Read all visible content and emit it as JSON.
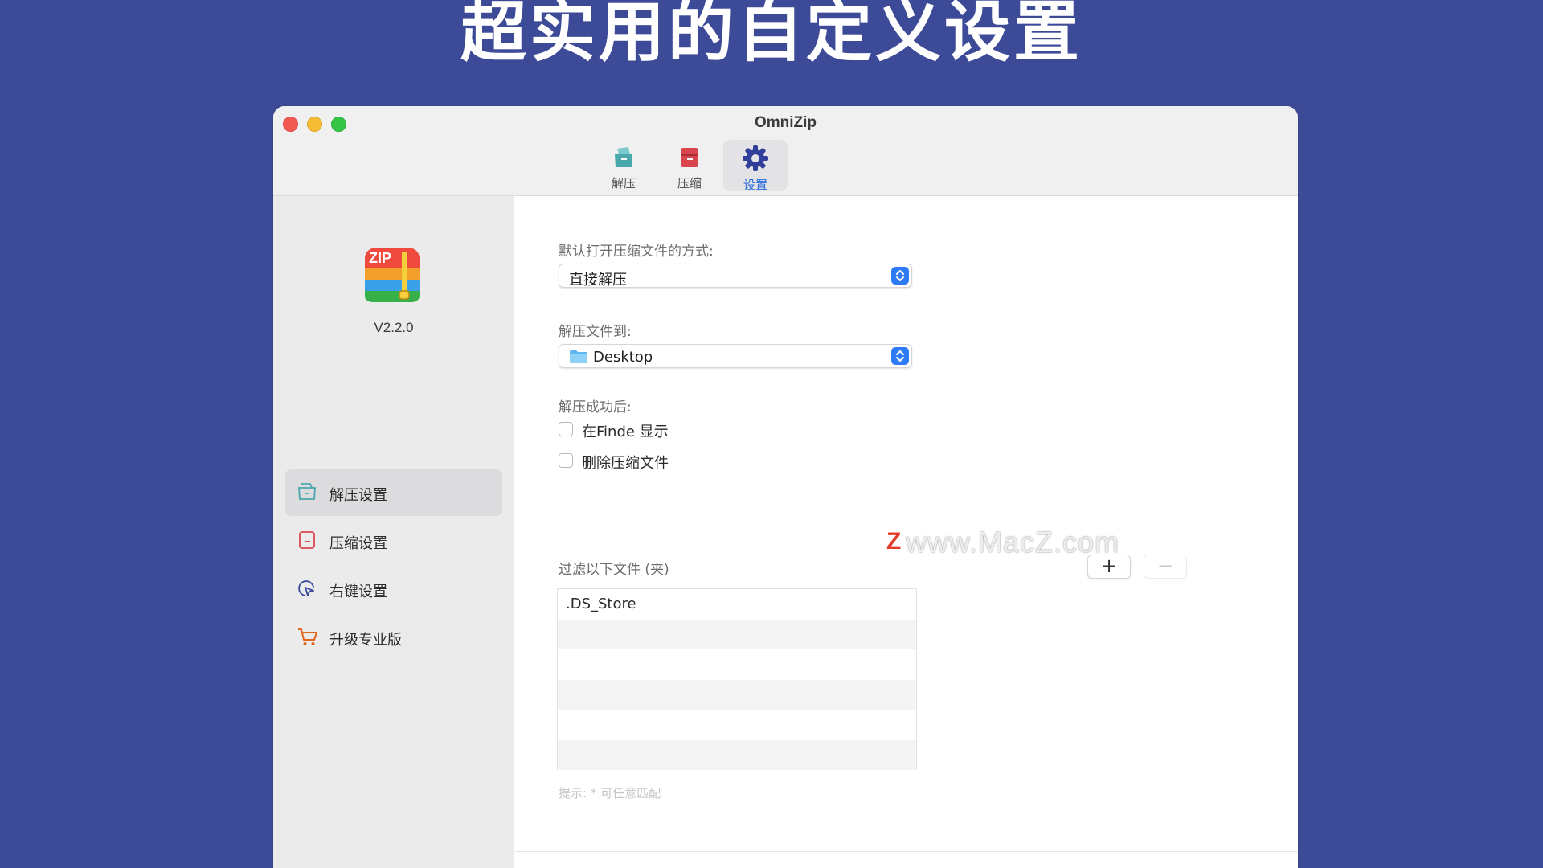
{
  "banner": {
    "title": "超实用的自定义设置"
  },
  "window": {
    "title": "OmniZip",
    "toolbar": [
      {
        "label": "解压",
        "icon": "extract-icon",
        "active": false
      },
      {
        "label": "压缩",
        "icon": "compress-icon",
        "active": false
      },
      {
        "label": "设置",
        "icon": "gear-icon",
        "active": true
      }
    ]
  },
  "sidebar": {
    "logo": {
      "text": "ZIP",
      "icon": "zip-logo-icon"
    },
    "version": "V2.2.0",
    "items": [
      {
        "label": "解压设置",
        "icon": "extract-settings-icon",
        "active": true
      },
      {
        "label": "压缩设置",
        "icon": "compress-settings-icon",
        "active": false
      },
      {
        "label": "右键设置",
        "icon": "right-click-icon",
        "active": false
      },
      {
        "label": "升级专业版",
        "icon": "cart-icon",
        "active": false
      }
    ]
  },
  "settings": {
    "open_method": {
      "label": "默认打开压缩文件的方式:",
      "value": "直接解压"
    },
    "extract_to": {
      "label": "解压文件到:",
      "value": "Desktop",
      "icon": "folder-icon"
    },
    "after_success": {
      "label": "解压成功后:",
      "options": [
        {
          "label": "在Finde  显示",
          "checked": false
        },
        {
          "label": "删除压缩文件",
          "checked": false
        }
      ]
    },
    "filter": {
      "label": "过滤以下文件 (夹)",
      "add_label": "+",
      "remove_label": "−",
      "items": [
        ".DS_Store",
        "",
        "",
        "",
        "",
        ""
      ]
    },
    "hint": "提示: * 可任意匹配"
  },
  "watermark": {
    "mark": "Z",
    "text": "www.MacZ.com"
  },
  "colors": {
    "background": "#3d4a97",
    "accent": "#2a6fdb",
    "stepper": "#2f7bf6"
  }
}
